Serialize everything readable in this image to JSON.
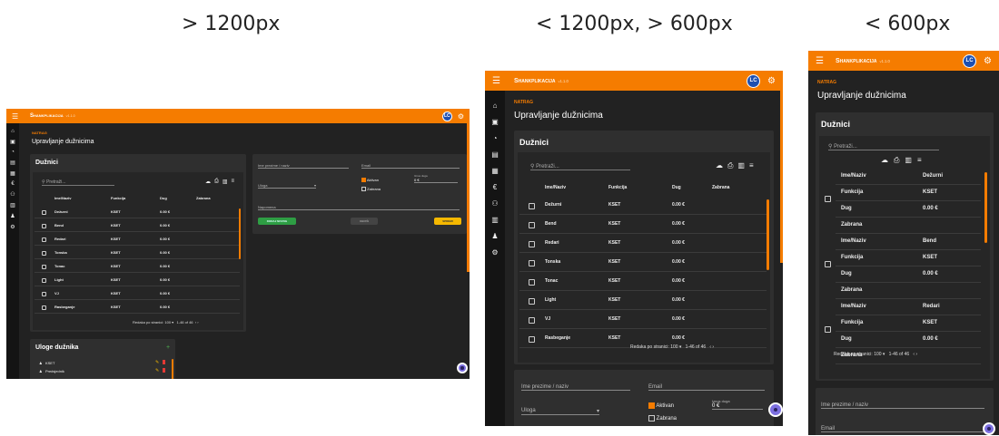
{
  "captions": {
    "large": "> 1200px",
    "medium": "< 1200px, > 600px",
    "small": "< 600px"
  },
  "app": {
    "brand": "Shankplikacija",
    "version": "v1.1.0",
    "avatar": "LC",
    "back": "NATRAG",
    "page_title": "Upravljanje dužnicima",
    "accent": "#f57c00"
  },
  "icons": {
    "menu": "hamburger-icon",
    "settings": "gear-icon",
    "sidebar": [
      "home-icon",
      "store-icon",
      "pie-icon",
      "receipt-icon",
      "calendar-icon",
      "euro-icon",
      "group-icon",
      "archive-icon",
      "person-icon",
      "gear-icon"
    ],
    "tools": [
      "cloud-download-icon",
      "print-icon",
      "columns-icon",
      "filter-icon"
    ]
  },
  "debtors": {
    "title": "Dužnici",
    "search_placeholder": "Pretraži...",
    "columns": [
      "Ime/Naziv",
      "Funkcija",
      "Dug",
      "Zabrana"
    ],
    "rows": [
      {
        "name": "Dežurni",
        "func": "KSET",
        "debt": "0.00 €"
      },
      {
        "name": "Bend",
        "func": "KSET",
        "debt": "0.00 €"
      },
      {
        "name": "Redari",
        "func": "KSET",
        "debt": "0.00 €"
      },
      {
        "name": "Tonska",
        "func": "KSET",
        "debt": "0.00 €"
      },
      {
        "name": "Tonac",
        "func": "KSET",
        "debt": "0.00 €"
      },
      {
        "name": "Light",
        "func": "KSET",
        "debt": "0.00 €"
      },
      {
        "name": "VJ",
        "func": "KSET",
        "debt": "0.00 €"
      },
      {
        "name": "Rasbeganje",
        "func": "KSET",
        "debt": "0.00 €"
      }
    ],
    "rows_per_page_label": "Redaka po stranici:",
    "rows_per_page": "100",
    "range": "1-46 of 46"
  },
  "form": {
    "name_label": "Ime prezime / naziv",
    "email_label": "Email",
    "role_label": "Uloga",
    "active_label": "Aktivan",
    "ban_label": "Zabrana",
    "debt_label": "Iznos duga",
    "debt_value": "0 €",
    "note_label": "Napomena",
    "add_button": "DODAJ NOVOG",
    "delete_button": "OBRIŠI",
    "save_button": "SPREMI"
  },
  "roles": {
    "title": "Uloge dužnika",
    "items": [
      "KSET",
      "Predsjednik"
    ]
  }
}
